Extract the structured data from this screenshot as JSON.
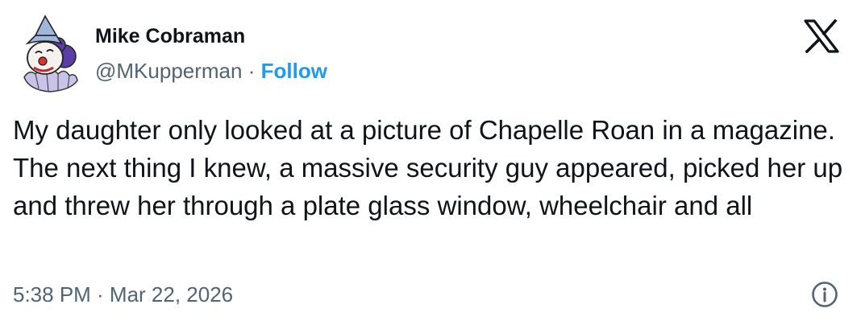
{
  "author": {
    "display_name": "Mike Cobraman",
    "handle": "@MKupperman",
    "separator": "·",
    "follow_label": "Follow",
    "avatar_icon": "clown-avatar-icon"
  },
  "platform_icon": "x-logo-icon",
  "tweet": {
    "text": "My daughter only looked at a picture of Chapelle Roan in a magazine. The next thing I knew, a massive security guy appeared, picked her up and threw her through a plate glass window, wheelchair and all",
    "timestamp": "5:38 PM · Mar 22, 2026"
  },
  "info_icon": "info-icon",
  "colors": {
    "text": "#0f1419",
    "secondary": "#536471",
    "accent": "#1d9bf0"
  }
}
